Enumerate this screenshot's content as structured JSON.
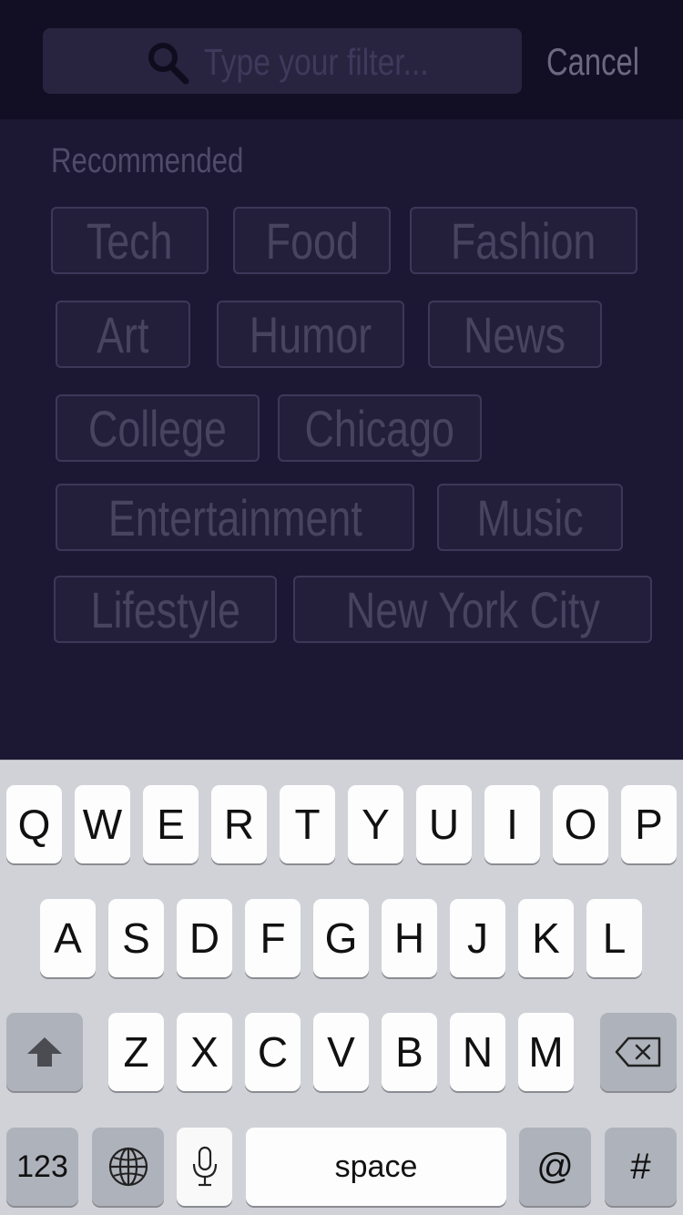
{
  "search": {
    "placeholder": "Type your filter...",
    "cancel_label": "Cancel"
  },
  "recommended": {
    "title": "Recommended",
    "tags": [
      "Tech",
      "Food",
      "Fashion",
      "Art",
      "Humor",
      "News",
      "College",
      "Chicago",
      "Entertainment",
      "Music",
      "Lifestyle",
      "New York City"
    ]
  },
  "keyboard": {
    "row1": [
      "Q",
      "W",
      "E",
      "R",
      "T",
      "Y",
      "U",
      "I",
      "O",
      "P"
    ],
    "row2": [
      "A",
      "S",
      "D",
      "F",
      "G",
      "H",
      "J",
      "K",
      "L"
    ],
    "row3": [
      "Z",
      "X",
      "C",
      "V",
      "B",
      "N",
      "M"
    ],
    "numbers_label": "123",
    "space_label": "space",
    "at_label": "@",
    "hash_label": "#",
    "icons": {
      "shift": "shift-arrow-icon",
      "delete": "backspace-icon",
      "globe": "globe-icon",
      "mic": "microphone-icon"
    }
  },
  "colors": {
    "background": "#1c1833",
    "header": "#120f24",
    "chip_border": "#3d3858",
    "chip_text": "#48435f",
    "keyboard_bg": "#d0d2d8"
  }
}
